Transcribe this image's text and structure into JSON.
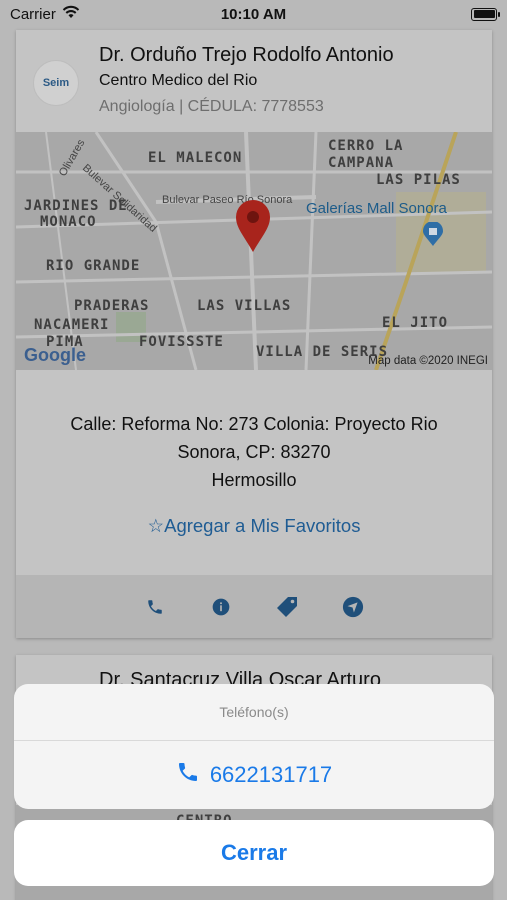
{
  "status_bar": {
    "carrier": "Carrier",
    "time": "10:10 AM"
  },
  "cards": [
    {
      "doctor_name": "Dr. Orduño Trejo Rodolfo Antonio",
      "clinic": "Centro Medico del Rio",
      "specialty": "Angiología | CÉDULA: 7778553",
      "logo_text": "Seim",
      "map": {
        "labels": [
          "EL MALECON",
          "CERRO LA",
          "CAMPANA",
          "LAS PILAS",
          "JARDINES DE",
          "MONACO",
          "RIO GRANDE",
          "PRADERAS",
          "LAS VILLAS",
          "NACAMERI",
          "EL JITO",
          "PIMA",
          "FOVISSSTE",
          "VILLA DE SERIS"
        ],
        "small_labels": [
          "Olivares",
          "Bulevar Solidaridad",
          "Bulevar Paseo Río Sonora"
        ],
        "poi": "Galerías Mall Sonora",
        "brand": "Google",
        "attribution": "Map data ©2020 INEGI"
      },
      "address_line1": "Calle: Reforma No: 273 Colonia: Proyecto Rio",
      "address_line2": "Sonora, CP: 83270",
      "city": "Hermosillo",
      "favorite_label": "☆Agregar a Mis Favoritos"
    },
    {
      "doctor_name": "Dr. Santacruz Villa Oscar Arturo",
      "map_label": "CENTRO"
    }
  ],
  "action_sheet": {
    "title": "Teléfono(s)",
    "phone": "6622131717",
    "cancel_label": "Cerrar"
  },
  "colors": {
    "accent": "#1a7ae8",
    "link_dimmed": "#1f5c93",
    "map_pin": "#b3261e"
  },
  "icons": [
    "wifi-icon",
    "battery-icon",
    "phone-icon",
    "info-icon",
    "tag-icon",
    "navigation-icon",
    "map-pin-icon"
  ]
}
